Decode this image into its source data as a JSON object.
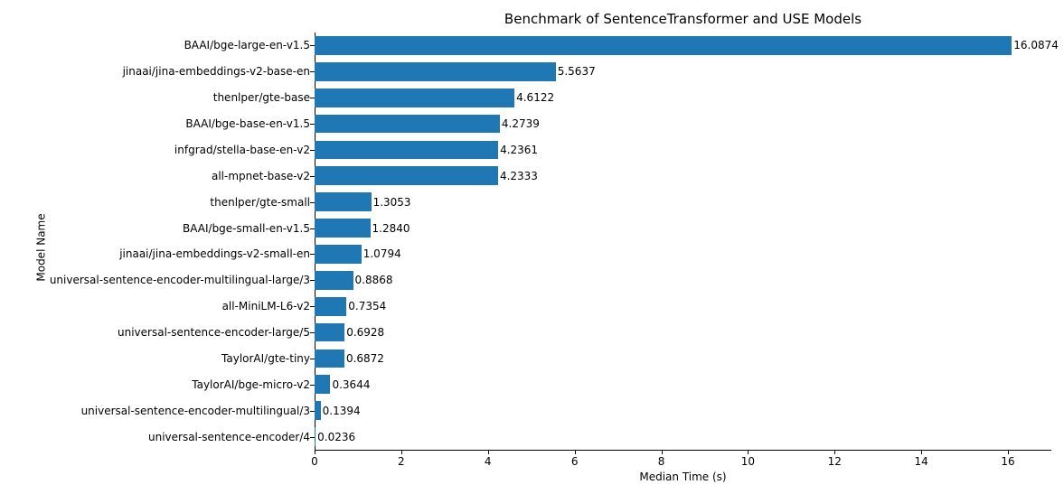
{
  "chart_data": {
    "type": "bar",
    "orientation": "horizontal",
    "title": "Benchmark of SentenceTransformer and USE Models",
    "xlabel": "Median Time (s)",
    "ylabel": "Model Name",
    "xlim": [
      0,
      17
    ],
    "xticks": [
      0,
      2,
      4,
      6,
      8,
      10,
      12,
      14,
      16
    ],
    "categories": [
      "BAAI/bge-large-en-v1.5",
      "jinaai/jina-embeddings-v2-base-en",
      "thenlper/gte-base",
      "BAAI/bge-base-en-v1.5",
      "infgrad/stella-base-en-v2",
      "all-mpnet-base-v2",
      "thenlper/gte-small",
      "BAAI/bge-small-en-v1.5",
      "jinaai/jina-embeddings-v2-small-en",
      "universal-sentence-encoder-multilingual-large/3",
      "all-MiniLM-L6-v2",
      "universal-sentence-encoder-large/5",
      "TaylorAI/gte-tiny",
      "TaylorAI/bge-micro-v2",
      "universal-sentence-encoder-multilingual/3",
      "universal-sentence-encoder/4"
    ],
    "values": [
      16.0874,
      5.5637,
      4.6122,
      4.2739,
      4.2361,
      4.2333,
      1.3053,
      1.284,
      1.0794,
      0.8868,
      0.7354,
      0.6928,
      0.6872,
      0.3644,
      0.1394,
      0.0236
    ],
    "value_labels": [
      "16.0874",
      "5.5637",
      "4.6122",
      "4.2739",
      "4.2361",
      "4.2333",
      "1.3053",
      "1.2840",
      "1.0794",
      "0.8868",
      "0.7354",
      "0.6928",
      "0.6872",
      "0.3644",
      "0.1394",
      "0.0236"
    ],
    "bar_color": "#1f77b4"
  }
}
